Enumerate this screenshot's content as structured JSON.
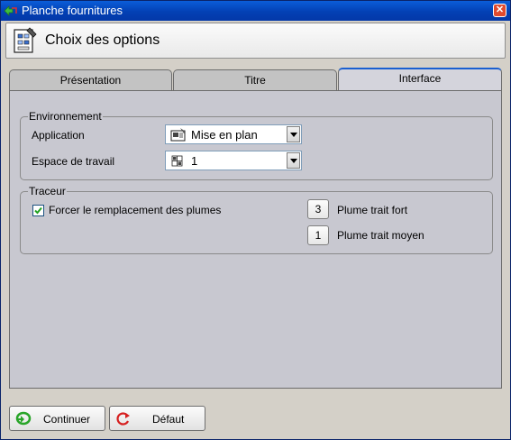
{
  "window": {
    "title": "Planche fournitures"
  },
  "header": {
    "title": "Choix des options"
  },
  "tabs": [
    {
      "label": "Présentation",
      "active": false
    },
    {
      "label": "Titre",
      "active": false
    },
    {
      "label": "Interface",
      "active": true
    }
  ],
  "environnement": {
    "title": "Environnement",
    "application": {
      "label": "Application",
      "value": "Mise en plan",
      "icon": "drawing-icon"
    },
    "espace": {
      "label": "Espace de travail",
      "value": "1",
      "icon": "grid-icon"
    }
  },
  "traceur": {
    "title": "Traceur",
    "checkbox": {
      "label": "Forcer le remplacement des plumes",
      "checked": true
    },
    "plume_fort": {
      "value": "3",
      "label": "Plume trait fort"
    },
    "plume_moyen": {
      "value": "1",
      "label": "Plume trait moyen"
    }
  },
  "buttons": {
    "continuer": "Continuer",
    "defaut": "Défaut"
  },
  "colors": {
    "titlebar": "#0340b4",
    "active_tab_border": "#1a5fd0",
    "panel": "#c8c8d0"
  }
}
